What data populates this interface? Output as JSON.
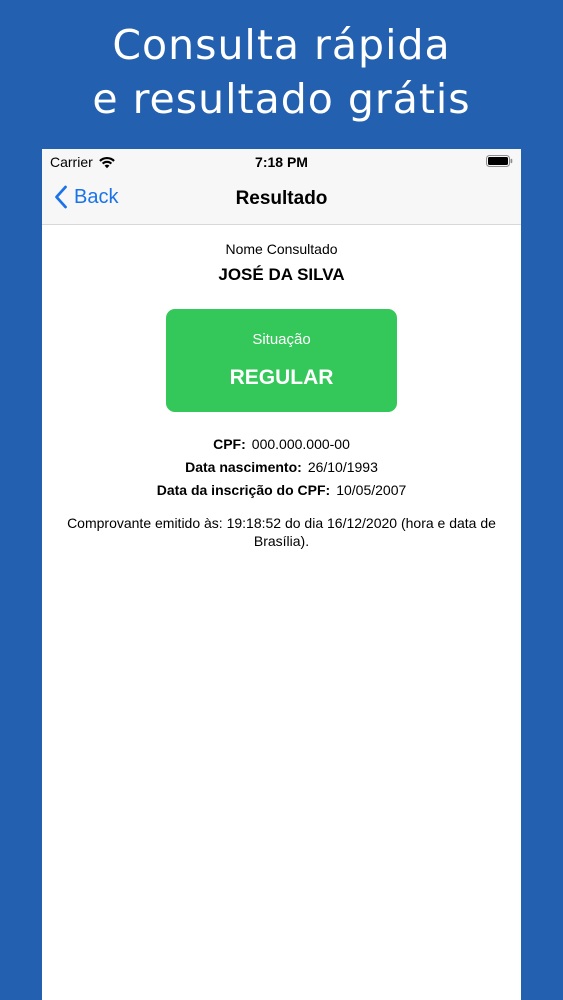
{
  "headline": {
    "line1": "Consulta rápida",
    "line2": "e resultado grátis"
  },
  "status_bar": {
    "carrier": "Carrier",
    "time": "7:18 PM",
    "icons": [
      "wifi-icon",
      "battery-icon"
    ]
  },
  "nav": {
    "back_label": "Back",
    "title": "Resultado",
    "accent_color": "#1a73e8"
  },
  "result": {
    "name_label": "Nome Consultado",
    "name_value": "JOSÉ DA SILVA",
    "status_label": "Situação",
    "status_value": "REGULAR",
    "status_color": "#34c759",
    "fields": [
      {
        "label": "CPF:",
        "value": "000.000.000-00"
      },
      {
        "label": "Data nascimento:",
        "value": "26/10/1993"
      },
      {
        "label": "Data da inscrição do CPF:",
        "value": "10/05/2007"
      }
    ],
    "issued_text": "Comprovante emitido às: 19:18:52 do dia 16/12/2020 (hora e data de Brasília)."
  },
  "colors": {
    "background": "#2460b0"
  }
}
